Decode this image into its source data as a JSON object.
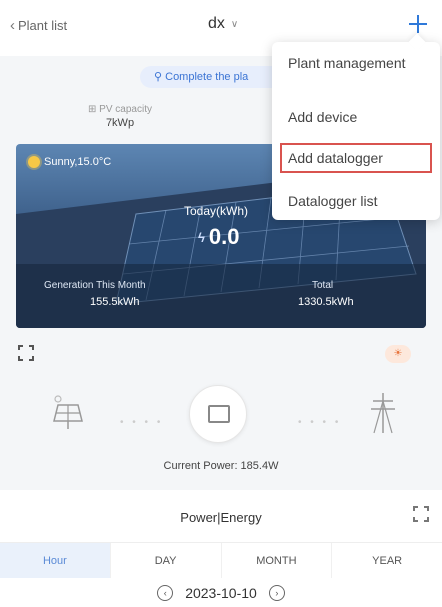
{
  "header": {
    "back_label": "Plant list",
    "plant_name": "dx"
  },
  "hint": {
    "complete_text": "Complete the pla"
  },
  "pv_capacity": {
    "label": "PV capacity",
    "value": "7kWp"
  },
  "hero": {
    "weather": "Sunny,15.0°C",
    "today_label": "Today(kWh)",
    "today_value": "0.0",
    "month_label": "Generation This Month",
    "month_value": "155.5kWh",
    "total_label": "Total",
    "total_value": "1330.5kWh"
  },
  "flow": {
    "current_power": "Current Power: 185.4W"
  },
  "energy_panel": {
    "title": "Power|Energy",
    "tabs": [
      "Hour",
      "DAY",
      "MONTH",
      "YEAR"
    ],
    "active_tab": "Hour",
    "date": "2023-10-10"
  },
  "menu": {
    "items": [
      "Plant management",
      "Add device",
      "Add datalogger",
      "Datalogger list"
    ],
    "highlighted": "Add datalogger"
  },
  "colors": {
    "accent": "#2f79d9",
    "highlight_border": "#d9534f",
    "active_tab_bg": "#eaf1fb"
  },
  "icons": [
    "chevron-left-icon",
    "chevron-down-icon",
    "plus-icon",
    "location-icon",
    "sun-icon",
    "bolt-icon",
    "expand-icon",
    "weather-badge-icon",
    "solar-panel-icon",
    "inverter-icon",
    "power-tower-icon",
    "arrow-left-circle-icon",
    "arrow-right-circle-icon"
  ]
}
